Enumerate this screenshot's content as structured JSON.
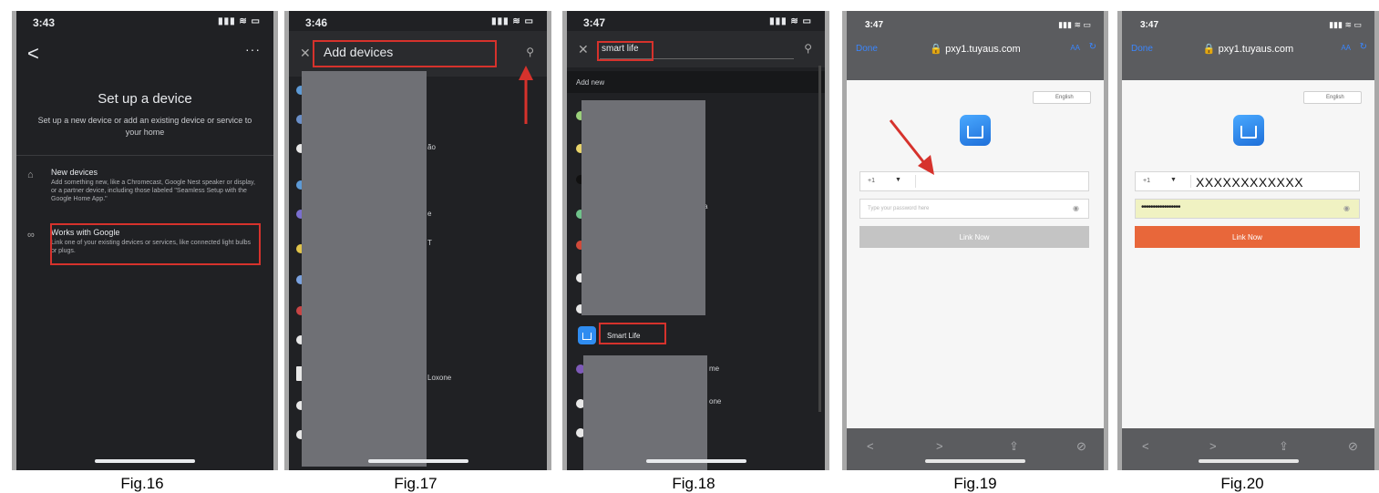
{
  "fig16": {
    "time": "3:43",
    "status_icons": "▮▮▮ ≋ ▭",
    "back": "<",
    "more": "···",
    "title": "Set up a device",
    "subtitle": "Set up a new device or add an existing device or service to your home",
    "options": [
      {
        "icon": "⌂",
        "title": "New devices",
        "desc": "Add something new, like a Chromecast, Google Nest speaker or display, or a partner device, including those labeled \"Seamless Setup with the Google Home App.\""
      },
      {
        "icon": "∞",
        "title": "Works with Google",
        "desc": "Link one of your existing devices or services, like connected light bulbs or plugs."
      }
    ],
    "caption": "Fig.16"
  },
  "fig17": {
    "time": "3:46",
    "status_icons": "▮▮▮ ≋ ▭",
    "close": "✕",
    "search_text": "Add devices",
    "search_icon": "⚲",
    "fragments": [
      "ão",
      "e",
      "T",
      "Loxone"
    ],
    "caption": "Fig.17"
  },
  "fig18": {
    "time": "3:47",
    "status_icons": "▮▮▮ ≋ ▭",
    "close": "✕",
    "search_text": "smart life",
    "search_icon": "⚲",
    "add_new": "Add new",
    "result_label": "Smart Life",
    "fragments": [
      "a",
      "me",
      "one"
    ],
    "caption": "Fig.18"
  },
  "fig19": {
    "time": "3:47",
    "status_icons": "▮▮▮ ≋ ▭",
    "done": "Done",
    "url": "🔒 pxy1.tuyaus.com",
    "aa": "AA",
    "reload": "↻",
    "language": "English",
    "country_code": "+1",
    "phone_value": "",
    "password_placeholder": "Type your password here",
    "password_value": "",
    "link_button": "Link Now",
    "nav_icons": [
      "<",
      ">",
      "⇪",
      "⊘"
    ],
    "caption": "Fig.19"
  },
  "fig20": {
    "time": "3:47",
    "status_icons": "▮▮▮ ≋ ▭",
    "done": "Done",
    "url": "🔒 pxy1.tuyaus.com",
    "aa": "AA",
    "reload": "↻",
    "language": "English",
    "country_code": "+1",
    "phone_value": "XXXXXXXXXXXX",
    "password_value": "•••••••••••••••••",
    "link_button": "Link Now",
    "nav_icons": [
      "<",
      ">",
      "⇪",
      "⊘"
    ],
    "caption": "Fig.20"
  },
  "colors": {
    "dark_bg": "#202124",
    "highlight_red": "#d6322c",
    "link_active": "#e8673a",
    "link_disabled": "#c4c4c4",
    "password_fill": "#f0f2c2",
    "app_blue": "#2f8cf0"
  }
}
